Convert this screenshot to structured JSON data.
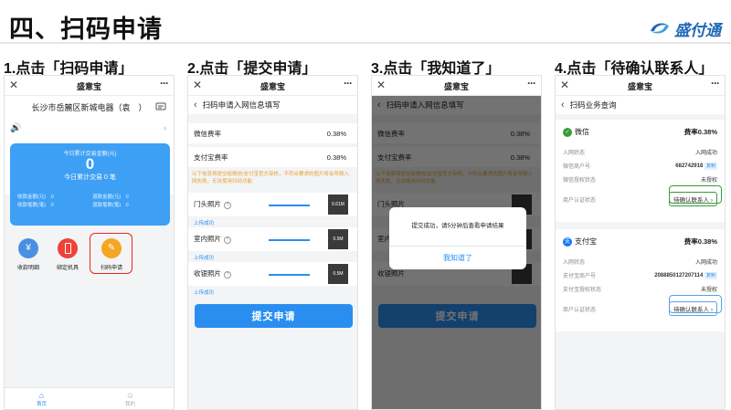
{
  "header": {
    "title": "四、扫码申请",
    "logo_text": "盛付通"
  },
  "steps": [
    "1.点击「扫码申请」",
    "2.点击「提交申请」",
    "3.点击「我知道了」",
    "4.点击「待确认联系人」"
  ],
  "app_name": "盛意宝",
  "phone1": {
    "store": "长沙市岳麓区新城电器（袁　）",
    "today_label": "今日累计交易金额(元)",
    "today_amount": "0",
    "today_count": "今日累计交易 0 笔",
    "left_stats": [
      "收款金额(元)　0",
      "收款笔数(笔)　0"
    ],
    "right_stats": [
      "退款金额(元)　0",
      "退款笔数(笔)　0"
    ],
    "menu": [
      "收款明细",
      "绑定机具",
      "扫码申请"
    ],
    "tabs": [
      "首页",
      "我的"
    ]
  },
  "phone2": {
    "subtitle": "扫码申请入网信息填写",
    "rates": [
      {
        "label": "微信费率",
        "value": "0.38%"
      },
      {
        "label": "支付宝费率",
        "value": "0.38%"
      }
    ],
    "notice": "以下信息将提交给微信/支付宝官方审核，不符合要求的图片将会导致入网失败，无法使用扫码功能",
    "photos": [
      {
        "label": "门头照片",
        "size": "0.61M",
        "status": "上传成功"
      },
      {
        "label": "室内照片",
        "size": "0.5M",
        "status": "上传成功"
      },
      {
        "label": "收银照片",
        "size": "0.5M",
        "status": "上传成功"
      }
    ],
    "submit": "提交申请"
  },
  "phone3": {
    "dialog_text": "提交成功，请5分钟后查看申请结果",
    "dialog_button": "我知道了"
  },
  "phone4": {
    "subtitle": "扫码业务查询",
    "wechat": {
      "name": "微信",
      "rate": "费率0.38%",
      "rows": [
        {
          "k": "入网状态",
          "v": "入网成功"
        },
        {
          "k": "微信商户号",
          "v": "682742918",
          "tag": "复制"
        },
        {
          "k": "微信授权状态",
          "v": "未授权"
        },
        {
          "k": "商户认证状态",
          "v": "待确认联系人"
        }
      ]
    },
    "alipay": {
      "name": "支付宝",
      "rate": "费率0.38%",
      "rows": [
        {
          "k": "入网状态",
          "v": "入网成功"
        },
        {
          "k": "支付宝商户号",
          "v": "2088850127207114",
          "tag": "复制"
        },
        {
          "k": "支付宝授权状态",
          "v": "未授权"
        },
        {
          "k": "商户认证状态",
          "v": "待确认联系人"
        }
      ]
    }
  },
  "colors": {
    "blue": "#2a8ef0",
    "wechat_green": "#3a9a3a",
    "alipay_blue": "#1677ff",
    "highlight_red": "#e22222"
  }
}
